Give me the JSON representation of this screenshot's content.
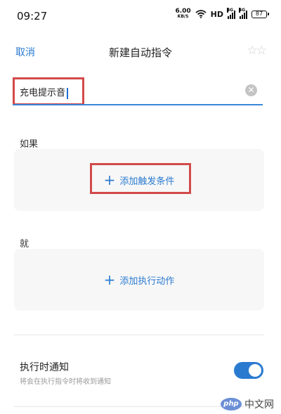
{
  "status_bar": {
    "time": "09:27",
    "speed_value": "6.00",
    "speed_unit": "KB/S",
    "network_label": "HD",
    "sim1_tag": "4G",
    "sim2_tag": "4G",
    "battery": "87"
  },
  "header": {
    "cancel_label": "取消",
    "title": "新建自动指令",
    "star_icon": "star-icon"
  },
  "name_field": {
    "value": "充电提示音",
    "clear_icon": "clear-icon"
  },
  "trigger_section": {
    "label": "如果",
    "add_label": "添加触发条件"
  },
  "action_section": {
    "label": "就",
    "add_label": "添加执行动作"
  },
  "notify": {
    "title": "执行时通知",
    "subtitle": "将会在执行指令时将收到通知",
    "enabled": true
  },
  "colors": {
    "accent": "#2a7bd0",
    "highlight_border": "#d24a4a",
    "panel_bg": "#f7f7f7"
  },
  "watermark": {
    "logo_text": "php",
    "text": "中文网"
  }
}
